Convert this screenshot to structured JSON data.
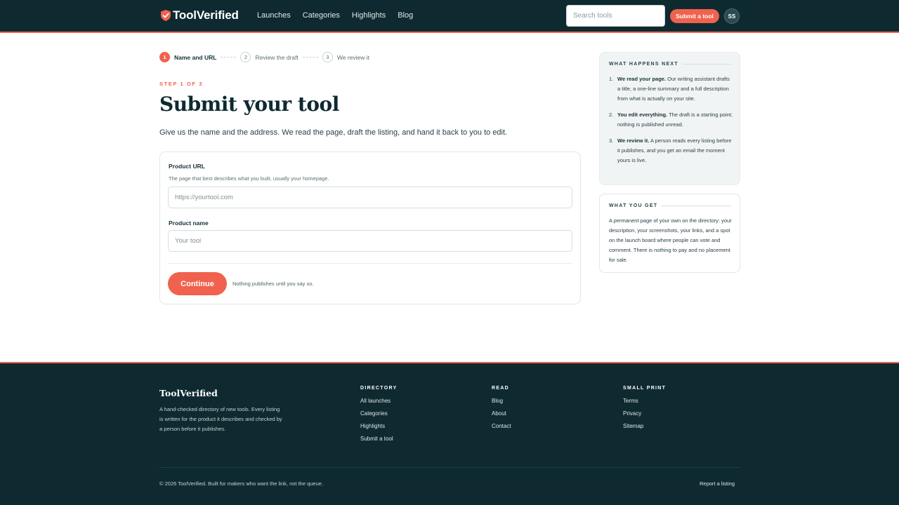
{
  "brand": {
    "name": "ToolVerified",
    "logo_icon": "shield-check-icon",
    "accent": "#f0624d",
    "dark": "#0e2a30"
  },
  "nav": {
    "links": [
      "Launches",
      "Categories",
      "Highlights",
      "Blog"
    ],
    "search_placeholder": "Search tools",
    "submit_label": "Submit a tool",
    "avatar_initials": "SS"
  },
  "stepper": {
    "steps": [
      {
        "num": "1",
        "label": "Name and URL",
        "state": "active"
      },
      {
        "num": "2",
        "label": "Review the draft",
        "state": "upcoming"
      },
      {
        "num": "3",
        "label": "We review it",
        "state": "upcoming"
      }
    ]
  },
  "main": {
    "eyebrow": "STEP 1 OF 3",
    "title": "Submit your tool",
    "lede": "Give us the name and the address. We read the page, draft the listing, and hand it back to you to edit."
  },
  "form": {
    "url_label": "Product URL",
    "url_help": "The page that best describes what you built, usually your homepage.",
    "url_placeholder": "https://yourtool.com",
    "url_value": "",
    "name_label": "Product name",
    "name_placeholder": "Your tool",
    "name_value": "",
    "continue_label": "Continue",
    "note": "Nothing publishes until you say so."
  },
  "aside": {
    "next_title": "WHAT HAPPENS NEXT",
    "next_items": [
      {
        "num": "1.",
        "bold": "We read your page.",
        "text": " Our writing assistant drafts a title, a one-line summary and a full description from what is actually on your site."
      },
      {
        "num": "2.",
        "bold": "You edit everything.",
        "text": " The draft is a starting point; nothing is published unread."
      },
      {
        "num": "3.",
        "bold": "We review it.",
        "text": " A person reads every listing before it publishes, and you get an email the moment yours is live."
      }
    ],
    "get_title": "WHAT YOU GET",
    "get_body": "A permanent page of your own on the directory: your description, your screenshots, your links, and a spot on the launch board where people can vote and comment. There is nothing to pay and no placement for sale."
  },
  "footer": {
    "brand": "ToolVerified",
    "blurb": "A hand-checked directory of new tools. Every listing is written for the product it describes and checked by a person before it publishes.",
    "columns": [
      {
        "title": "DIRECTORY",
        "links": [
          "All launches",
          "Categories",
          "Highlights",
          "Submit a tool"
        ]
      },
      {
        "title": "READ",
        "links": [
          "Blog",
          "About",
          "Contact"
        ]
      },
      {
        "title": "SMALL PRINT",
        "links": [
          "Terms",
          "Privacy",
          "Sitemap"
        ]
      }
    ],
    "copyright": "© 2026 ToolVerified. Built for makers who want the link, not the queue.",
    "report_label": "Report a listing"
  }
}
